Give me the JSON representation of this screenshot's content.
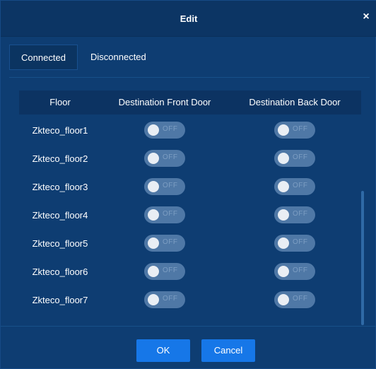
{
  "dialog": {
    "title": "Edit",
    "close_glyph": "×"
  },
  "tabs": [
    {
      "label": "Connected",
      "active": true
    },
    {
      "label": "Disconnected",
      "active": false
    }
  ],
  "table": {
    "headers": [
      "Floor",
      "Destination Front Door",
      "Destination Back Door"
    ],
    "toggle_off_label": "OFF",
    "rows": [
      {
        "floor": "Zkteco_floor1",
        "front": "OFF",
        "back": "OFF"
      },
      {
        "floor": "Zkteco_floor2",
        "front": "OFF",
        "back": "OFF"
      },
      {
        "floor": "Zkteco_floor3",
        "front": "OFF",
        "back": "OFF"
      },
      {
        "floor": "Zkteco_floor4",
        "front": "OFF",
        "back": "OFF"
      },
      {
        "floor": "Zkteco_floor5",
        "front": "OFF",
        "back": "OFF"
      },
      {
        "floor": "Zkteco_floor6",
        "front": "OFF",
        "back": "OFF"
      },
      {
        "floor": "Zkteco_floor7",
        "front": "OFF",
        "back": "OFF"
      }
    ]
  },
  "buttons": {
    "ok": "OK",
    "cancel": "Cancel"
  },
  "colors": {
    "background": "#0e3d72",
    "header_bg": "#0c3362",
    "toggle_off": "#4f78a6",
    "primary_button": "#1677e8"
  },
  "icons": {
    "close": "close-icon",
    "toggle_knob": "toggle-knob-icon"
  }
}
